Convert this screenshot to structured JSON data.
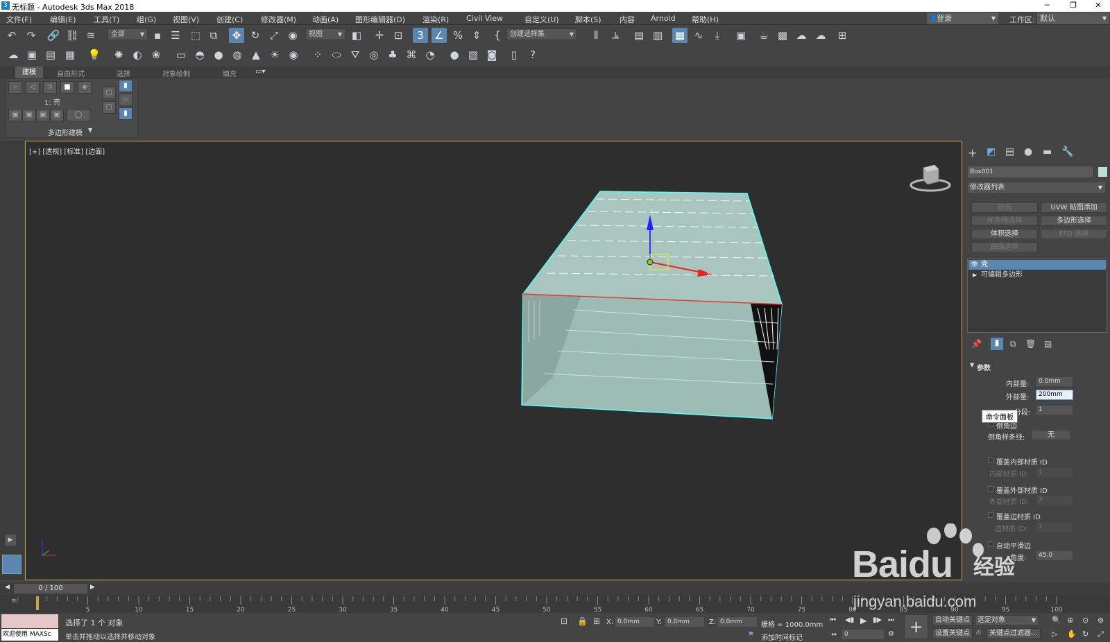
{
  "window": {
    "title": "无标题 - Autodesk 3ds Max 2018",
    "controls": [
      "─",
      "❐",
      "✕"
    ]
  },
  "menu": {
    "items": [
      "文件(F)",
      "编辑(E)",
      "工具(T)",
      "组(G)",
      "视图(V)",
      "创建(C)",
      "修改器(M)",
      "动画(A)",
      "图形编辑器(D)",
      "渲染(R)",
      "Civil View",
      "自定义(U)",
      "脚本(S)",
      "内容",
      "Arnold",
      "帮助(H)"
    ],
    "login": "登录",
    "workspace_label": "工作区:",
    "workspace_value": "默认"
  },
  "toolbar": {
    "filter_all": "全部",
    "view_ref": "视图",
    "selection_set": "创建选择集",
    "snap_label": "3",
    "percent": "%"
  },
  "ribbon": {
    "tabs": [
      "建模",
      "自由形式",
      "选择",
      "对象绘制",
      "填充"
    ],
    "active_tab": "建模",
    "level_label": "1: 壳",
    "panel_title": "多边形建模"
  },
  "viewport": {
    "label": "[+] [透视] [标准] [边面]",
    "axis_x": "x",
    "axis_y": "y",
    "axis_z": "z",
    "border_color": "#c7a94a"
  },
  "command_panel": {
    "object_name": "Box001",
    "object_color": "#b7e1d9",
    "modifier_list": "修改器列表",
    "buttons": [
      {
        "label": "挤出",
        "enabled": false
      },
      {
        "label": "UVW 贴图添加",
        "enabled": true
      },
      {
        "label": "样条线选择",
        "enabled": false
      },
      {
        "label": "多边形选择",
        "enabled": true
      },
      {
        "label": "体积选择",
        "enabled": true
      },
      {
        "label": "FFD 选择",
        "enabled": false
      },
      {
        "label": "曲面选择",
        "enabled": false
      }
    ],
    "stack": [
      {
        "label": "壳",
        "selected": true
      },
      {
        "label": "可编辑多边形",
        "selected": false
      }
    ],
    "params": {
      "title": "参数",
      "inner_amount_label": "内部量:",
      "inner_amount": "0.0mm",
      "outer_amount_label": "外部量:",
      "outer_amount": "200mm",
      "segments_label": "分段:",
      "segments": "1",
      "bevel_edges": "倒角边",
      "bevel_spline_label": "倒角样条线:",
      "bevel_spline_value": "无",
      "override_inner": "覆盖内部材质 ID",
      "inner_mat_label": "内部材质 ID:",
      "inner_mat": "1",
      "override_outer": "覆盖外部材质 ID",
      "outer_mat_label": "外部材质 ID:",
      "outer_mat": "3",
      "override_edge": "覆盖边材质 ID",
      "edge_mat_label": "边材质 ID:",
      "edge_mat": "1",
      "auto_smooth": "自动平滑边",
      "angle_label": "角度:",
      "angle": "45.0"
    },
    "tooltip": "命令面板"
  },
  "timeline": {
    "slider": "0 / 100",
    "ticks": [
      "5",
      "10",
      "15",
      "20",
      "25",
      "30",
      "35",
      "40",
      "45",
      "50",
      "55",
      "60",
      "65",
      "70",
      "75",
      "80",
      "85",
      "90",
      "95",
      "100"
    ]
  },
  "status": {
    "welcome": "欢迎使用 MAXSc",
    "selected": "选择了 1 个 对象",
    "hint": "单击并拖动以选择并移动对象",
    "x_label": "X:",
    "x": "0.0mm",
    "y_label": "Y:",
    "y": "0.0mm",
    "z_label": "Z:",
    "z": "0.0mm",
    "grid": "栅格 = 1000.0mm",
    "add_time_tag": "添加时间标记",
    "auto_key": "自动关键点",
    "selected_object": "选定对象",
    "set_key": "设置关键点",
    "key_filter": "关键点过滤器...",
    "frame": "0"
  },
  "watermark": {
    "brand": "Baidu",
    "product": "经验",
    "url": "jingyan.baidu.com"
  }
}
